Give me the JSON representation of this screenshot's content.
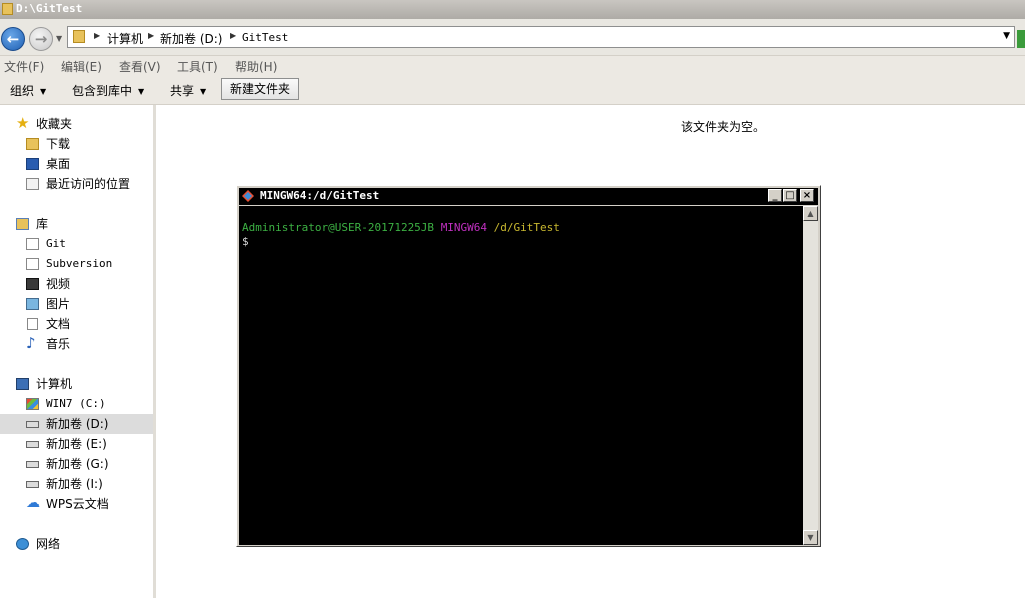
{
  "window": {
    "title": "D:\\GitTest"
  },
  "address": {
    "crumbs": [
      "计算机",
      "新加卷 (D:)",
      "GitTest"
    ]
  },
  "menubar": [
    "文件(F)",
    "编辑(E)",
    "查看(V)",
    "工具(T)",
    "帮助(H)"
  ],
  "toolbar": {
    "organize": "组织",
    "include_in_library": "包含到库中",
    "share": "共享",
    "new_folder": "新建文件夹"
  },
  "sidebar": {
    "favorites": {
      "label": "收藏夹",
      "items": [
        "下载",
        "桌面",
        "最近访问的位置"
      ]
    },
    "libraries": {
      "label": "库",
      "items": [
        "Git",
        "Subversion",
        "视频",
        "图片",
        "文档",
        "音乐"
      ]
    },
    "computer": {
      "label": "计算机",
      "items": [
        "WIN7 (C:)",
        "新加卷 (D:)",
        "新加卷 (E:)",
        "新加卷 (G:)",
        "新加卷 (I:)",
        "WPS云文档"
      ]
    },
    "network": {
      "label": "网络"
    }
  },
  "content": {
    "empty_message": "该文件夹为空。"
  },
  "terminal": {
    "title": "MINGW64:/d/GitTest",
    "prompt_user": "Administrator@USER-20171225JB",
    "prompt_env": "MINGW64",
    "prompt_path": "/d/GitTest",
    "prompt_symbol": "$",
    "colors": {
      "user": "#3cb043",
      "env": "#c030c0",
      "path": "#c8b830",
      "text": "#dcdcdc"
    }
  },
  "icons": [
    "back-arrow-icon",
    "forward-arrow-icon",
    "folder-icon",
    "star-icon",
    "download-folder-icon",
    "desktop-icon",
    "recent-places-icon",
    "library-icon",
    "drive-icon",
    "cloud-icon",
    "network-icon",
    "computer-icon"
  ]
}
